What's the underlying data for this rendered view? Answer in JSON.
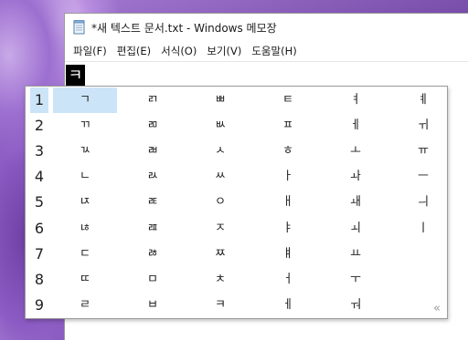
{
  "window": {
    "title": "*새 텍스트 문서.txt - Windows 메모장",
    "menu": [
      {
        "label": "파일(F)"
      },
      {
        "label": "편집(E)"
      },
      {
        "label": "서식(O)"
      },
      {
        "label": "보기(V)"
      },
      {
        "label": "도움말(H)"
      }
    ]
  },
  "editor": {
    "composing_char": "ㅋ"
  },
  "ime": {
    "selected_index": 1,
    "more_icon": "chevron-double-right-icon",
    "more_glyph": "«",
    "rows": [
      {
        "num": "1",
        "cells": [
          "ㄱ",
          "ㄺ",
          "ㅃ",
          "ㅌ",
          "ㅕ",
          "ㅖ"
        ]
      },
      {
        "num": "2",
        "cells": [
          "ㄲ",
          "ㄻ",
          "ㅄ",
          "ㅍ",
          "ㅔ",
          "ㅟ"
        ]
      },
      {
        "num": "3",
        "cells": [
          "ㄳ",
          "ㄼ",
          "ㅅ",
          "ㅎ",
          "ㅗ",
          "ㅠ"
        ]
      },
      {
        "num": "4",
        "cells": [
          "ㄴ",
          "ㄽ",
          "ㅆ",
          "ㅏ",
          "ㅘ",
          "ㅡ"
        ]
      },
      {
        "num": "5",
        "cells": [
          "ㄵ",
          "ㄾ",
          "ㅇ",
          "ㅐ",
          "ㅙ",
          "ㅢ"
        ]
      },
      {
        "num": "6",
        "cells": [
          "ㄶ",
          "ㄿ",
          "ㅈ",
          "ㅑ",
          "ㅚ",
          "ㅣ"
        ]
      },
      {
        "num": "7",
        "cells": [
          "ㄷ",
          "ㅀ",
          "ㅉ",
          "ㅒ",
          "ㅛ",
          ""
        ]
      },
      {
        "num": "8",
        "cells": [
          "ㄸ",
          "ㅁ",
          "ㅊ",
          "ㅓ",
          "ㅜ",
          ""
        ]
      },
      {
        "num": "9",
        "cells": [
          "ㄹ",
          "ㅂ",
          "ㅋ",
          "ㅔ",
          "ㅝ",
          ""
        ]
      }
    ]
  },
  "colors": {
    "selection": "#cce4f7",
    "composing_bg": "#000000"
  }
}
